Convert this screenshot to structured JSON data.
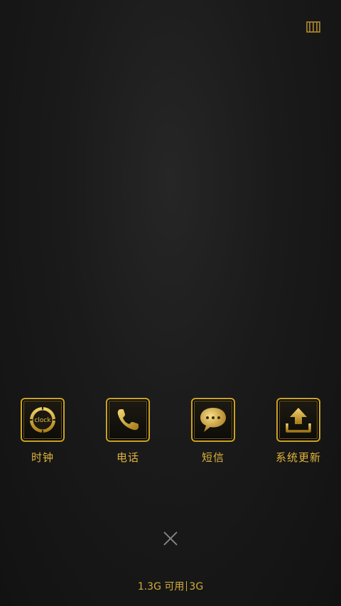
{
  "apps": [
    {
      "label": "时钟",
      "icon": "clock-icon",
      "icon_text": "clock"
    },
    {
      "label": "电话",
      "icon": "phone-icon"
    },
    {
      "label": "短信",
      "icon": "message-icon"
    },
    {
      "label": "系统更新",
      "icon": "system-update-icon"
    }
  ],
  "storage": {
    "available": "1.3G 可用",
    "total": "3G"
  },
  "colors": {
    "gold": "#c9a227",
    "gold_text": "#e0b43a",
    "background": "#1a1a1a"
  }
}
